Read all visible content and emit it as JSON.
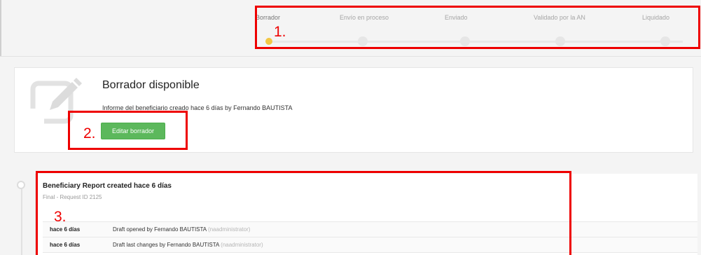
{
  "progress_steps": [
    {
      "label": "Borrador",
      "state": "active"
    },
    {
      "label": "Envío en proceso",
      "state": "pending"
    },
    {
      "label": "Enviado",
      "state": "pending"
    },
    {
      "label": "Validado por la AN",
      "state": "pending"
    },
    {
      "label": "Liquidado",
      "state": "pending"
    }
  ],
  "draft": {
    "title": "Borrador disponible",
    "subtitle": "Informe del beneficiario creado hace 6 días by Fernando BAUTISTA",
    "edit_button": "Editar borrador"
  },
  "report": {
    "title": "Beneficiary Report created hace 6 días",
    "subtitle": "Final - Request ID 2125",
    "activity": [
      {
        "time": "hace 6 días",
        "text": "Draft opened by Fernando BAUTISTA",
        "user": "(naadministrator)"
      },
      {
        "time": "hace 6 días",
        "text": "Draft last changes by Fernando BAUTISTA",
        "user": "(naadministrator)"
      }
    ]
  },
  "annotations": [
    {
      "number": "1.",
      "target": "progress-steps"
    },
    {
      "number": "2.",
      "target": "edit-draft-button"
    },
    {
      "number": "3.",
      "target": "report-panel"
    }
  ],
  "colors": {
    "active_step": "#f2c744",
    "button_green": "#5cb85c",
    "annotation_red": "#ee0000"
  },
  "icons": {
    "draft": "pencil-edit-icon"
  }
}
